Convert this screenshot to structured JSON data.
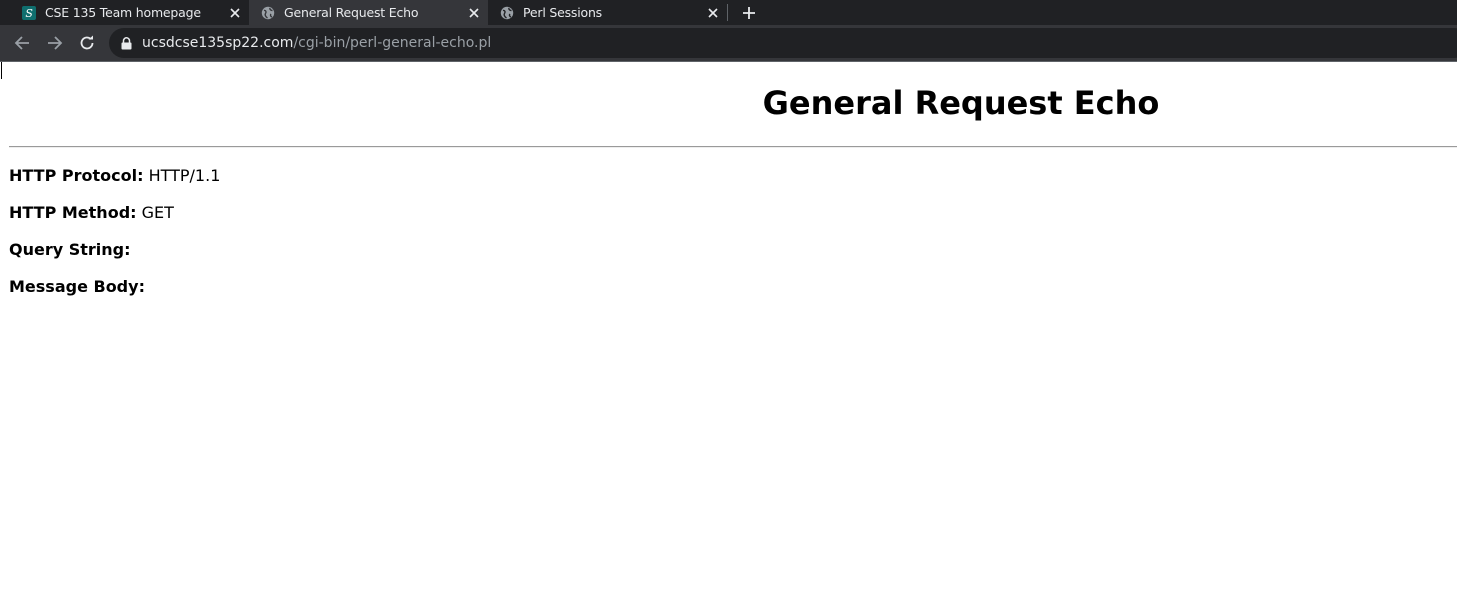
{
  "browser": {
    "tabs": [
      {
        "title": "CSE 135 Team homepage",
        "icon": "s-favicon-icon",
        "active": false
      },
      {
        "title": "General Request Echo",
        "icon": "globe-icon",
        "active": true
      },
      {
        "title": "Perl Sessions",
        "icon": "globe-icon",
        "active": false
      }
    ],
    "url_host": "ucsdcse135sp22.com",
    "url_path": "/cgi-bin/perl-general-echo.pl",
    "colors": {
      "tabstrip": "#202124",
      "toolbar": "#35363a",
      "omnibox": "#202124",
      "text": "#e8eaed",
      "muted": "#9aa0a6",
      "favicon_bg": "#0f6e6e"
    }
  },
  "page": {
    "title": "General Request Echo",
    "fields": [
      {
        "label": "HTTP Protocol:",
        "value": "HTTP/1.1"
      },
      {
        "label": "HTTP Method:",
        "value": "GET"
      },
      {
        "label": "Query String:",
        "value": ""
      },
      {
        "label": "Message Body:",
        "value": ""
      }
    ]
  }
}
